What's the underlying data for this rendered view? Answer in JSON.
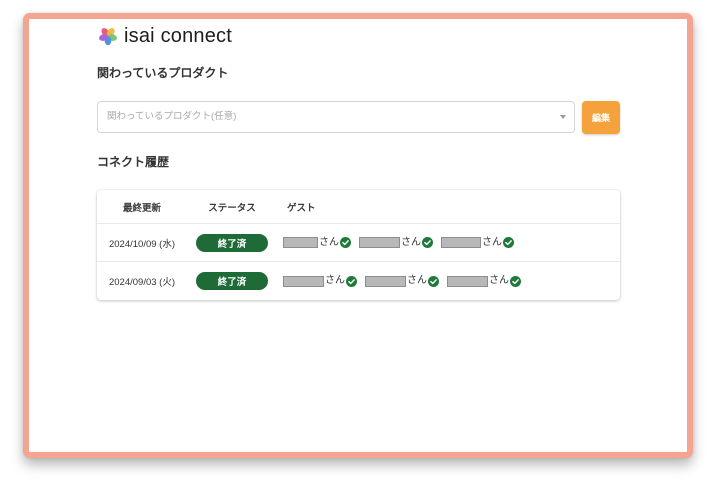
{
  "app": {
    "logo_text": "isai connect"
  },
  "products": {
    "heading": "関わっているプロダクト",
    "select_placeholder": "関わっているプロダクト(任意)",
    "edit_label": "編集"
  },
  "history": {
    "heading": "コネクト履歴",
    "columns": [
      "最終更新",
      "ステータス",
      "ゲスト"
    ],
    "rows": [
      {
        "updated": "2024/10/09 (水)",
        "status": "終了済",
        "guests": [
          {
            "honorific": "さん",
            "checked": true
          },
          {
            "honorific": "さん",
            "checked": true
          },
          {
            "honorific": "さん",
            "checked": true
          }
        ]
      },
      {
        "updated": "2024/09/03 (火)",
        "status": "終了済",
        "guests": [
          {
            "honorific": "さん",
            "checked": true
          },
          {
            "honorific": "さん",
            "checked": true
          },
          {
            "honorific": "さん",
            "checked": true
          }
        ]
      }
    ]
  },
  "icons": {
    "logo": "flower-logo-icon",
    "select_toggle": "chevron-down-icon",
    "guest_status": "check-circle-icon"
  },
  "colors": {
    "frame_border": "#f4a48f",
    "edit_button": "#f6a23c",
    "status_done_badge": "#1f6b37",
    "guest_check": "#1f7a3a",
    "logo_petals": [
      "#ee5a7e",
      "#f6b840",
      "#7cc576",
      "#4f93e0",
      "#a36ad6"
    ]
  }
}
